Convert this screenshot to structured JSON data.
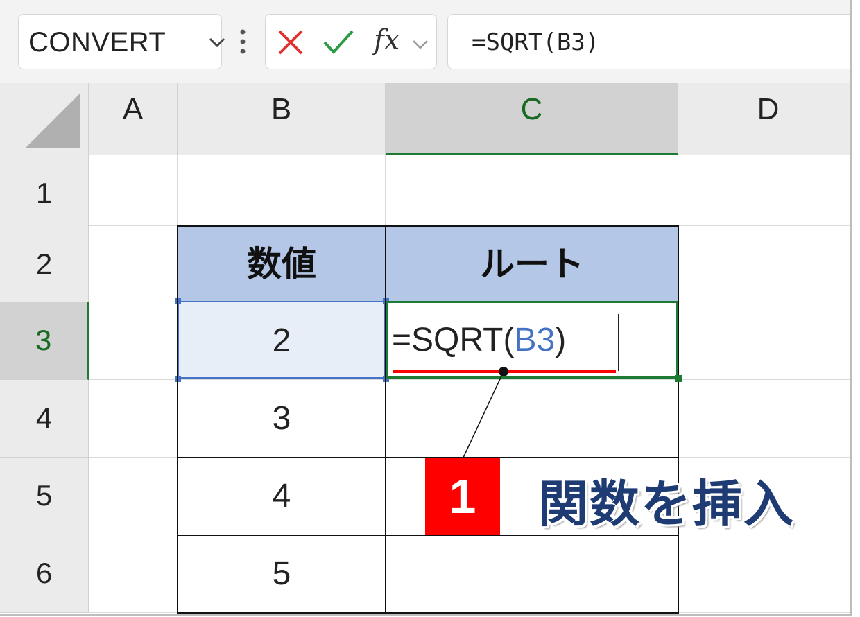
{
  "namebox": {
    "value": "CONVERT"
  },
  "formula_bar": {
    "fx_label": "fx",
    "formula": "=SQRT(B3)"
  },
  "columns": [
    "A",
    "B",
    "C",
    "D"
  ],
  "rows": [
    "1",
    "2",
    "3",
    "4",
    "5",
    "6"
  ],
  "selected_column": "C",
  "selected_row": "3",
  "table": {
    "header": [
      "数値",
      "ルート"
    ],
    "values": [
      "2",
      "3",
      "4",
      "5"
    ]
  },
  "edit_cell": {
    "prefix": "=SQRT(",
    "ref": "B3",
    "suffix": ")"
  },
  "annotation": {
    "badge": "1",
    "text": "関数を挿入"
  },
  "colors": {
    "header_fill": "#b4c7e7",
    "selection_green": "#1e7b34",
    "ref_blue": "#4472c4",
    "badge_red": "#ff0000",
    "annotation_navy": "#1f3b73"
  }
}
